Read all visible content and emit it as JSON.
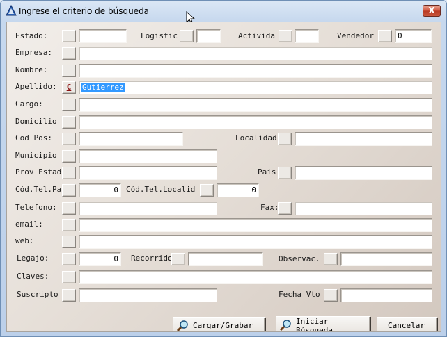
{
  "window": {
    "title": "Ingrese el criterio de búsqueda",
    "close_label": "X"
  },
  "form": {
    "estado": {
      "label": "Estado:",
      "value": ""
    },
    "logistica": {
      "label": "Logistic",
      "value": ""
    },
    "actividad": {
      "label": "Activida",
      "value": ""
    },
    "vendedor": {
      "label": "Vendedor",
      "value": "0"
    },
    "empresa": {
      "label": "Empresa:",
      "value": ""
    },
    "nombre": {
      "label": "Nombre:",
      "value": ""
    },
    "apellido": {
      "label": "Apellido:",
      "button": "C",
      "value": "Gutierrez"
    },
    "cargo": {
      "label": "Cargo:",
      "value": ""
    },
    "domicilio": {
      "label": "Domicilio",
      "value": ""
    },
    "cod_pos": {
      "label": "Cod Pos:",
      "value": ""
    },
    "localidad": {
      "label": "Localidad",
      "value": ""
    },
    "municipio": {
      "label": "Municipio",
      "value": ""
    },
    "prov_estado": {
      "label": "Prov Estad",
      "value": ""
    },
    "pais": {
      "label": "Pais",
      "value": ""
    },
    "cod_tel_pais": {
      "label": "Cód.Tel.Pa",
      "value": "0"
    },
    "cod_tel_localidad": {
      "label": "Cód.Tel.Localid",
      "value": "0"
    },
    "telefono": {
      "label": "Telefono:",
      "value": ""
    },
    "fax": {
      "label": "Fax:",
      "value": ""
    },
    "email": {
      "label": "email:",
      "value": ""
    },
    "web": {
      "label": "web:",
      "value": ""
    },
    "legajo": {
      "label": "Legajo:",
      "value": "0"
    },
    "recorrido": {
      "label": "Recorrido",
      "value": ""
    },
    "observac": {
      "label": "Observac.",
      "value": ""
    },
    "claves": {
      "label": "Claves:",
      "value": ""
    },
    "suscripto": {
      "label": "Suscripto",
      "value": ""
    },
    "fecha_vto": {
      "label": "Fecha Vto",
      "value": ""
    }
  },
  "footer": {
    "cargar_grabar": "Cargar/Grabar",
    "iniciar_busqueda": "Iniciar\nBúsqueda",
    "cancelar": "Cancelar"
  }
}
